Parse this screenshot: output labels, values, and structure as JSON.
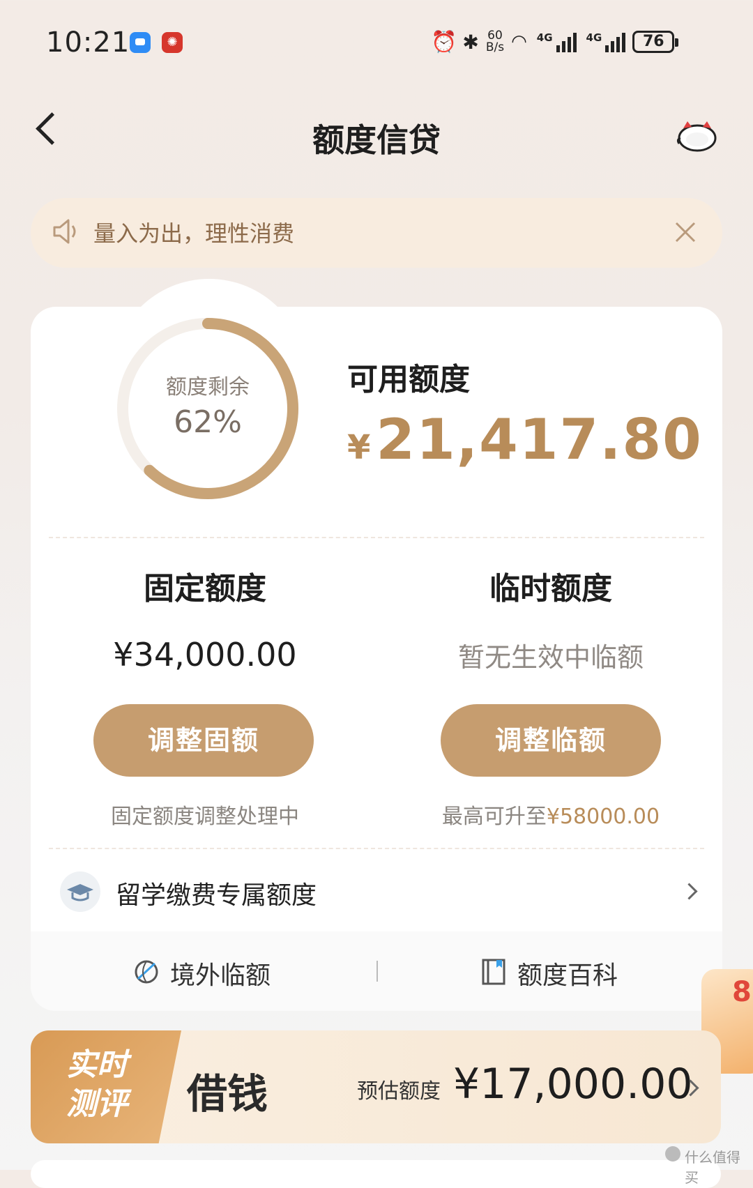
{
  "status_bar": {
    "time": "10:21",
    "net_speed_value": "60",
    "net_speed_unit": "B/s",
    "network_1": "4G",
    "network_2": "4G",
    "battery": "76"
  },
  "nav": {
    "title": "额度信贷"
  },
  "notice": {
    "text": "量入为出，理性消费"
  },
  "credit": {
    "ring_label": "额度剩余",
    "ring_percent": "62%",
    "ring_fraction": 0.62,
    "available_label": "可用额度",
    "available_currency": "¥",
    "available_amount": "21,417.80"
  },
  "fixed": {
    "title": "固定额度",
    "amount": "¥34,000.00",
    "button": "调整固额",
    "note": "固定额度调整处理中"
  },
  "temporary": {
    "title": "临时额度",
    "status": "暂无生效中临额",
    "button": "调整临额",
    "note_prefix": "最高可升至",
    "note_amount": "¥58000.00"
  },
  "study": {
    "label": "留学缴费专属额度"
  },
  "links": {
    "overseas": "境外临额",
    "wiki": "额度百科"
  },
  "loan": {
    "tag_line1": "实时",
    "tag_line2": "测评",
    "title": "借钱",
    "estimate_label": "预估额度",
    "estimate_amount": "¥17,000.00"
  },
  "deco_text": "8",
  "watermark": "什么值得买",
  "colors": {
    "accent": "#c69d6f",
    "amount": "#b88c59",
    "notice_bg": "#f8ecdf"
  }
}
